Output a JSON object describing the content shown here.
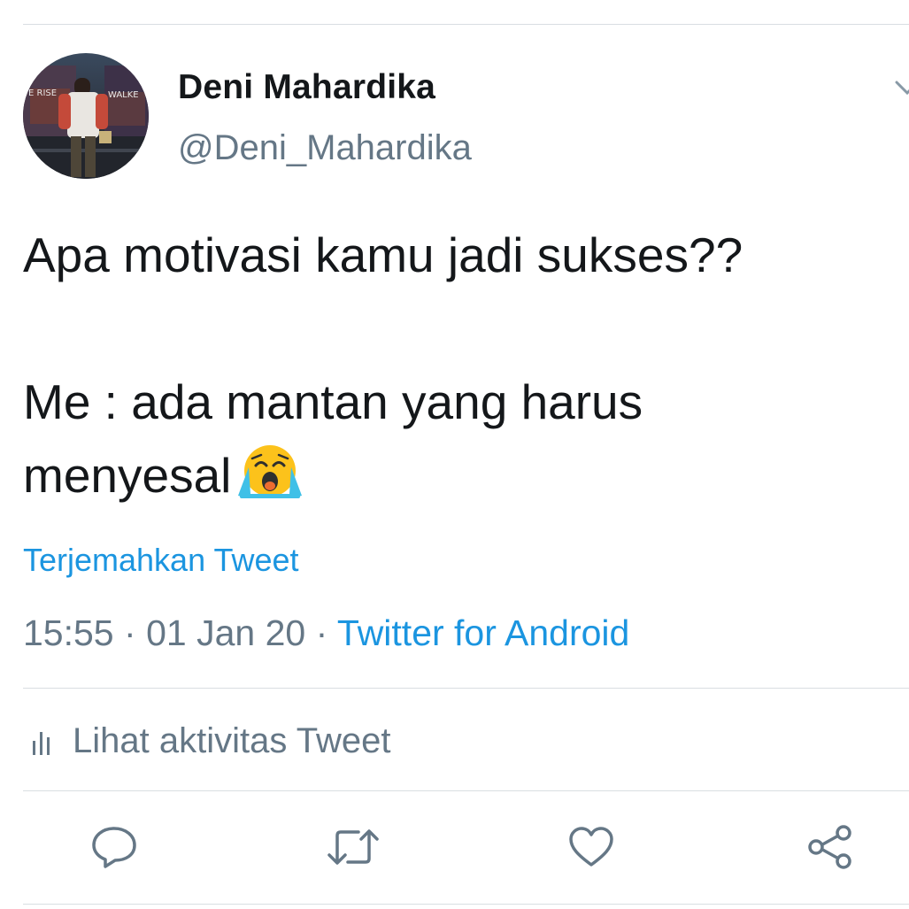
{
  "author": {
    "display_name": "Deni Mahardika",
    "handle": "@Deni_Mahardika",
    "avatar_text_left": "E RISE",
    "avatar_text_right": "WALKE"
  },
  "tweet": {
    "line1": "Apa motivasi kamu jadi sukses??",
    "line2": "Me : ada mantan yang harus",
    "line3": "menyesal",
    "emoji": "loudly-crying-face"
  },
  "translate_label": "Terjemahkan Tweet",
  "meta": {
    "time": "15:55",
    "separator": "·",
    "date": "01 Jan 20",
    "source": "Twitter for Android"
  },
  "activity_label": "Lihat aktivitas Tweet",
  "actions": {
    "reply_icon": "speech-bubble-icon",
    "retweet_icon": "retweet-icon",
    "like_icon": "heart-icon",
    "share_icon": "share-icon"
  },
  "colors": {
    "text": "#14171a",
    "secondary": "#657786",
    "link": "#1b95e0",
    "divider": "#d9dee2"
  }
}
